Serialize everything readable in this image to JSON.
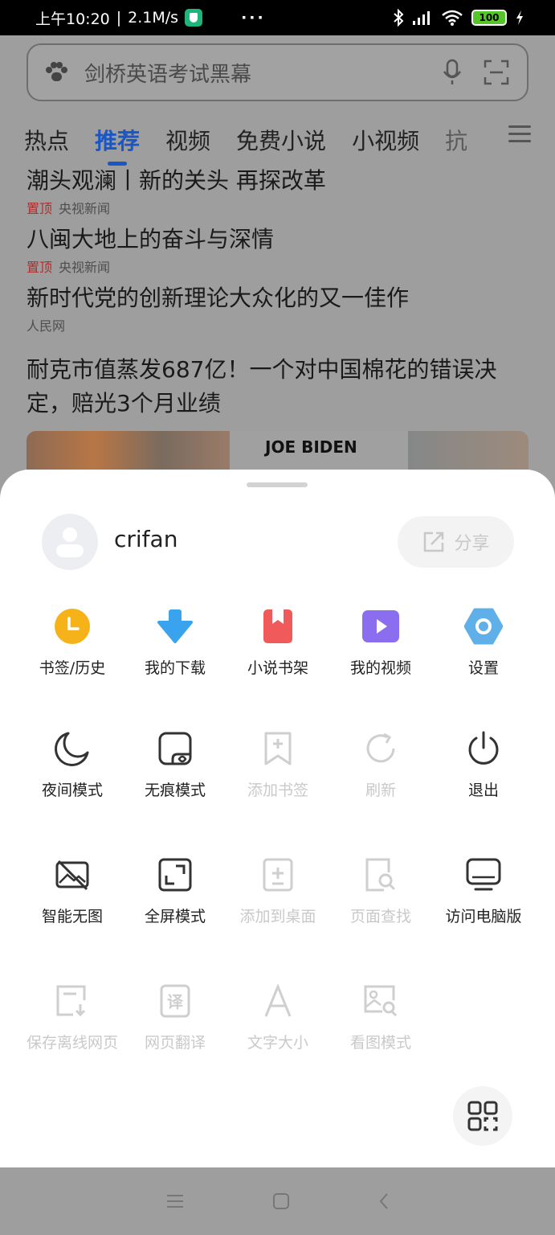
{
  "status_bar": {
    "time": "上午10:20",
    "speed": "2.1M/s",
    "more": "···",
    "battery": "100"
  },
  "search": {
    "text": "剑桥英语考试黑幕"
  },
  "tabs": [
    {
      "label": "热点"
    },
    {
      "label": "推荐"
    },
    {
      "label": "视频"
    },
    {
      "label": "免费小说"
    },
    {
      "label": "小视频"
    },
    {
      "label": "抗"
    }
  ],
  "news": [
    {
      "title": "潮头观澜丨新的关头 再探改革",
      "pin": "置顶",
      "source": "央视新闻"
    },
    {
      "title": "八闽大地上的奋斗与深情",
      "pin": "置顶",
      "source": "央视新闻"
    },
    {
      "title": "新时代党的创新理论大众化的又一佳作",
      "pin": "",
      "source": "人民网"
    },
    {
      "title": "耐克市值蒸发687亿！一个对中国棉花的错误决定，赔光3个月业绩",
      "pin": "",
      "source": ""
    }
  ],
  "thumb_caption": "JOE BIDEN",
  "sheet": {
    "username": "crifan",
    "share_label": "分享",
    "rows": [
      [
        {
          "label": "书签/历史",
          "icon": "clock-icon",
          "enabled": true
        },
        {
          "label": "我的下载",
          "icon": "download-icon",
          "enabled": true
        },
        {
          "label": "小说书架",
          "icon": "bookshelf-icon",
          "enabled": true
        },
        {
          "label": "我的视频",
          "icon": "video-icon",
          "enabled": true
        },
        {
          "label": "设置",
          "icon": "settings-icon",
          "enabled": true
        }
      ],
      [
        {
          "label": "夜间模式",
          "icon": "moon-icon",
          "enabled": true
        },
        {
          "label": "无痕模式",
          "icon": "incognito-icon",
          "enabled": true
        },
        {
          "label": "添加书签",
          "icon": "add-bookmark-icon",
          "enabled": false
        },
        {
          "label": "刷新",
          "icon": "refresh-icon",
          "enabled": false
        },
        {
          "label": "退出",
          "icon": "power-icon",
          "enabled": true
        }
      ],
      [
        {
          "label": "智能无图",
          "icon": "no-image-icon",
          "enabled": true
        },
        {
          "label": "全屏模式",
          "icon": "fullscreen-icon",
          "enabled": true
        },
        {
          "label": "添加到桌面",
          "icon": "add-desktop-icon",
          "enabled": false
        },
        {
          "label": "页面查找",
          "icon": "find-in-page-icon",
          "enabled": false
        },
        {
          "label": "访问电脑版",
          "icon": "desktop-version-icon",
          "enabled": true
        }
      ],
      [
        {
          "label": "保存离线网页",
          "icon": "save-offline-icon",
          "enabled": false
        },
        {
          "label": "网页翻译",
          "icon": "translate-icon",
          "enabled": false
        },
        {
          "label": "文字大小",
          "icon": "font-size-icon",
          "enabled": false
        },
        {
          "label": "看图模式",
          "icon": "image-view-icon",
          "enabled": false
        }
      ]
    ]
  },
  "colors": {
    "accent": "#1a56c4",
    "pin": "#b12c2c",
    "disabled": "#c9c9c9"
  }
}
